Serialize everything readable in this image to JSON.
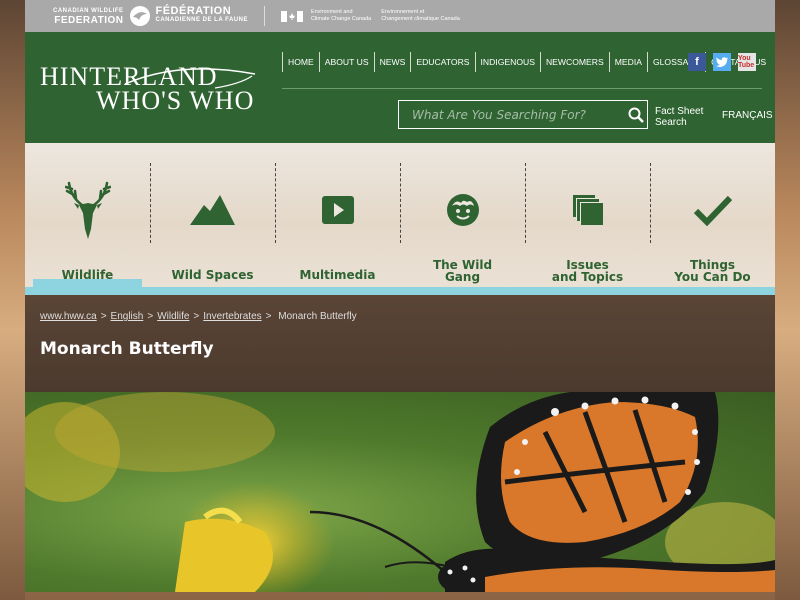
{
  "partner": {
    "cwf_small_en": "CANADIAN WILDLIFE",
    "cwf_big_en": "FEDERATION",
    "cwf_big_fr": "FÉDÉRATION",
    "cwf_small_fr": "CANADIENNE DE LA FAUNE",
    "eccc_en_1": "Environment and",
    "eccc_en_2": "Climate Change Canada",
    "eccc_fr_1": "Environnement et",
    "eccc_fr_2": "Changement climatique Canada"
  },
  "logo": {
    "line1": "HINTERLAND",
    "line2": "WHO'S WHO"
  },
  "nav": [
    "HOME",
    "ABOUT US",
    "NEWS",
    "EDUCATORS",
    "INDIGENOUS",
    "NEWCOMERS",
    "MEDIA",
    "GLOSSARY",
    "CONTACT US"
  ],
  "social": {
    "facebook": "f",
    "twitter": "t",
    "youtube": "You Tube"
  },
  "search": {
    "placeholder": "What Are You Searching For?"
  },
  "fact_sheet": {
    "line1": "Fact Sheet",
    "line2": "Search"
  },
  "lang": "FRANÇAIS",
  "categories": [
    {
      "label": "Wildlife",
      "icon": "deer-icon"
    },
    {
      "label": "Wild Spaces",
      "icon": "mountain-icon"
    },
    {
      "label": "Multimedia",
      "icon": "play-icon"
    },
    {
      "label1": "The Wild",
      "label2": "Gang",
      "icon": "face-icon"
    },
    {
      "label1": "Issues",
      "label2": "and Topics",
      "icon": "pages-icon"
    },
    {
      "label1": "Things",
      "label2": "You Can Do",
      "icon": "checkmark-icon"
    }
  ],
  "breadcrumb": {
    "home": "www.hww.ca",
    "english": "English",
    "wildlife": "Wildlife",
    "invertebrates": "Invertebrates",
    "current": "Monarch Butterfly"
  },
  "page_title": "Monarch Butterfly",
  "colors": {
    "green": "#2f6332",
    "accent": "#8dd3e0",
    "grey_bar": "#a9a9a9"
  }
}
